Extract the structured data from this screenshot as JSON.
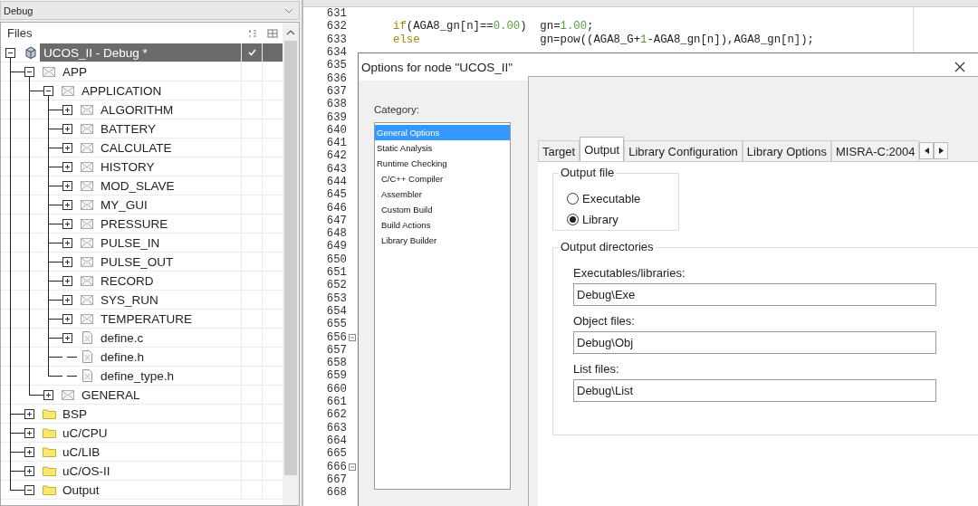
{
  "configuration": {
    "value": "Debug"
  },
  "workspace": {
    "header": "Files",
    "tree": [
      {
        "label": "UCOS_II - Debug *",
        "kind": "project",
        "expandable": true,
        "expanded": true,
        "selected": true,
        "checked": true,
        "children": [
          {
            "label": "APP",
            "kind": "group",
            "expandable": true,
            "expanded": true,
            "selected": false,
            "checked": false,
            "children": [
              {
                "label": "APPLICATION",
                "kind": "group",
                "expandable": true,
                "expanded": true,
                "selected": false,
                "checked": false,
                "children": [
                  {
                    "label": "ALGORITHM",
                    "kind": "group",
                    "expandable": true,
                    "expanded": false,
                    "selected": false,
                    "checked": false
                  },
                  {
                    "label": "BATTERY",
                    "kind": "group",
                    "expandable": true,
                    "expanded": false,
                    "selected": false,
                    "checked": false
                  },
                  {
                    "label": "CALCULATE",
                    "kind": "group",
                    "expandable": true,
                    "expanded": false,
                    "selected": false,
                    "checked": false
                  },
                  {
                    "label": "HISTORY",
                    "kind": "group",
                    "expandable": true,
                    "expanded": false,
                    "selected": false,
                    "checked": false
                  },
                  {
                    "label": "MOD_SLAVE",
                    "kind": "group",
                    "expandable": true,
                    "expanded": false,
                    "selected": false,
                    "checked": false
                  },
                  {
                    "label": "MY_GUI",
                    "kind": "group",
                    "expandable": true,
                    "expanded": false,
                    "selected": false,
                    "checked": false
                  },
                  {
                    "label": "PRESSURE",
                    "kind": "group",
                    "expandable": true,
                    "expanded": false,
                    "selected": false,
                    "checked": false
                  },
                  {
                    "label": "PULSE_IN",
                    "kind": "group",
                    "expandable": true,
                    "expanded": false,
                    "selected": false,
                    "checked": false
                  },
                  {
                    "label": "PULSE_OUT",
                    "kind": "group",
                    "expandable": true,
                    "expanded": false,
                    "selected": false,
                    "checked": false
                  },
                  {
                    "label": "RECORD",
                    "kind": "group",
                    "expandable": true,
                    "expanded": false,
                    "selected": false,
                    "checked": false
                  },
                  {
                    "label": "SYS_RUN",
                    "kind": "group",
                    "expandable": true,
                    "expanded": false,
                    "selected": false,
                    "checked": false
                  },
                  {
                    "label": "TEMPERATURE",
                    "kind": "group",
                    "expandable": true,
                    "expanded": false,
                    "selected": false,
                    "checked": false
                  },
                  {
                    "label": "define.c",
                    "kind": "file",
                    "expandable": true,
                    "expanded": false,
                    "selected": false,
                    "checked": false
                  },
                  {
                    "label": "define.h",
                    "kind": "file",
                    "expandable": false,
                    "expanded": false,
                    "selected": false,
                    "checked": false
                  },
                  {
                    "label": "define_type.h",
                    "kind": "file",
                    "expandable": false,
                    "expanded": false,
                    "selected": false,
                    "checked": false
                  }
                ]
              },
              {
                "label": "GENERAL",
                "kind": "group",
                "expandable": true,
                "expanded": false,
                "selected": false,
                "checked": false
              }
            ]
          },
          {
            "label": "BSP",
            "kind": "folder",
            "expandable": true,
            "expanded": false,
            "selected": false,
            "checked": false
          },
          {
            "label": "uC/CPU",
            "kind": "folder",
            "expandable": true,
            "expanded": false,
            "selected": false,
            "checked": false
          },
          {
            "label": "uC/LIB",
            "kind": "folder",
            "expandable": true,
            "expanded": false,
            "selected": false,
            "checked": false
          },
          {
            "label": "uC/OS-II",
            "kind": "folder",
            "expandable": true,
            "expanded": false,
            "selected": false,
            "checked": false
          },
          {
            "label": "Output",
            "kind": "folder",
            "expandable": true,
            "expanded": true,
            "selected": false,
            "checked": false
          }
        ]
      }
    ]
  },
  "editor": {
    "lines": [
      {
        "number": "631",
        "fold": false
      },
      {
        "number": "632",
        "fold": false,
        "code": [
          {
            "kind": "keyword",
            "text": "if"
          },
          {
            "kind": "plain",
            "text": "(AGA8_gn[n]=="
          },
          {
            "kind": "number",
            "text": "0.00"
          },
          {
            "kind": "plain",
            "text": ")  gn="
          },
          {
            "kind": "number",
            "text": "1.00"
          },
          {
            "kind": "plain",
            "text": ";"
          }
        ]
      },
      {
        "number": "633",
        "fold": false,
        "code": [
          {
            "kind": "keyword",
            "text": "else"
          },
          {
            "kind": "plain",
            "text": "                  gn=pow((AGA8_G+"
          },
          {
            "kind": "number",
            "text": "1"
          },
          {
            "kind": "plain",
            "text": "-AGA8_gn[n]),AGA8_gn[n]);"
          }
        ]
      },
      {
        "number": "634",
        "fold": false
      },
      {
        "number": "635",
        "fold": false
      },
      {
        "number": "636",
        "fold": false
      },
      {
        "number": "637",
        "fold": false
      },
      {
        "number": "638",
        "fold": false
      },
      {
        "number": "639",
        "fold": false
      },
      {
        "number": "640",
        "fold": false
      },
      {
        "number": "641",
        "fold": false
      },
      {
        "number": "642",
        "fold": false
      },
      {
        "number": "643",
        "fold": false
      },
      {
        "number": "644",
        "fold": false
      },
      {
        "number": "645",
        "fold": false
      },
      {
        "number": "646",
        "fold": false
      },
      {
        "number": "647",
        "fold": false
      },
      {
        "number": "648",
        "fold": false
      },
      {
        "number": "649",
        "fold": false
      },
      {
        "number": "650",
        "fold": false
      },
      {
        "number": "651",
        "fold": false
      },
      {
        "number": "652",
        "fold": false
      },
      {
        "number": "653",
        "fold": false
      },
      {
        "number": "654",
        "fold": false
      },
      {
        "number": "655",
        "fold": false
      },
      {
        "number": "656",
        "fold": true
      },
      {
        "number": "657",
        "fold": false
      },
      {
        "number": "658",
        "fold": false
      },
      {
        "number": "659",
        "fold": false
      },
      {
        "number": "660",
        "fold": false
      },
      {
        "number": "661",
        "fold": false
      },
      {
        "number": "662",
        "fold": false
      },
      {
        "number": "663",
        "fold": false
      },
      {
        "number": "664",
        "fold": false
      },
      {
        "number": "665",
        "fold": false
      },
      {
        "number": "666",
        "fold": true
      },
      {
        "number": "667",
        "fold": false
      },
      {
        "number": "668",
        "fold": false
      }
    ]
  },
  "dialog": {
    "title": "Options for node \"UCOS_II\"",
    "category_label": "Category:",
    "categories": [
      {
        "label": "General Options",
        "kind": "main",
        "selected": true
      },
      {
        "label": "Static Analysis",
        "kind": "main",
        "selected": false
      },
      {
        "label": "Runtime Checking",
        "kind": "main",
        "selected": false
      },
      {
        "label": "C/C++ Compiler",
        "kind": "tool",
        "selected": false
      },
      {
        "label": "Assembler",
        "kind": "tool",
        "selected": false
      },
      {
        "label": "Custom Build",
        "kind": "tool",
        "selected": false
      },
      {
        "label": "Build Actions",
        "kind": "tool",
        "selected": false
      },
      {
        "label": "Library Builder",
        "kind": "tool",
        "selected": false
      }
    ],
    "tabs": [
      {
        "label": "Target",
        "selected": false
      },
      {
        "label": "Output",
        "selected": true
      },
      {
        "label": "Library Configuration",
        "selected": false
      },
      {
        "label": "Library Options",
        "selected": false
      },
      {
        "label": "MISRA-C:2004",
        "selected": false
      }
    ],
    "output_file": {
      "legend": "Output file",
      "options": [
        {
          "label": "Executable",
          "selected": false
        },
        {
          "label": "Library",
          "selected": true
        }
      ]
    },
    "output_directories": {
      "legend": "Output directories",
      "fields": [
        {
          "label": "Executables/libraries:",
          "value": "Debug\\Exe"
        },
        {
          "label": "Object files:",
          "value": "Debug\\Obj"
        },
        {
          "label": "List files:",
          "value": "Debug\\List"
        }
      ]
    }
  }
}
